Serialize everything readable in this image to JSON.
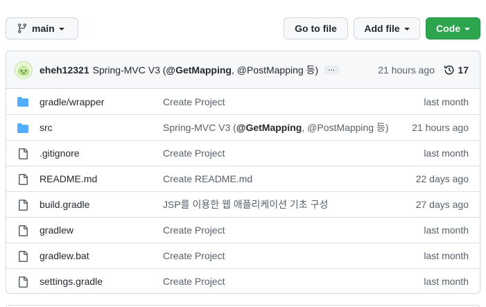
{
  "toolbar": {
    "branch_label": "main",
    "goto_file_label": "Go to file",
    "add_file_label": "Add file",
    "code_label": "Code"
  },
  "commit": {
    "author": "eheh12321",
    "message_prefix": "Spring-MVC V3 (",
    "message_bold": "@GetMapping",
    "message_suffix": ", @PostMapping 등)",
    "ellipsis": "…",
    "time": "21 hours ago",
    "history_count": "17"
  },
  "files": [
    {
      "name": "gradle/wrapper",
      "type": "folder",
      "msg": "Create Project",
      "age": "last month"
    },
    {
      "name": "src",
      "type": "folder",
      "msg_prefix": "Spring-MVC V3 (",
      "msg_bold": "@GetMapping",
      "msg_suffix": ", @PostMapping 등)",
      "age": "21 hours ago"
    },
    {
      "name": ".gitignore",
      "type": "file",
      "msg": "Create Project",
      "age": "last month"
    },
    {
      "name": "README.md",
      "type": "file",
      "msg": "Create README.md",
      "age": "22 days ago"
    },
    {
      "name": "build.gradle",
      "type": "file",
      "msg": "JSP를 이용한 웹 애플리케이션 기초 구성",
      "age": "27 days ago"
    },
    {
      "name": "gradlew",
      "type": "file",
      "msg": "Create Project",
      "age": "last month"
    },
    {
      "name": "gradlew.bat",
      "type": "file",
      "msg": "Create Project",
      "age": "last month"
    },
    {
      "name": "settings.gradle",
      "type": "file",
      "msg": "Create Project",
      "age": "last month"
    }
  ],
  "colors": {
    "folder": "#54aeff",
    "file_icon": "#57606a",
    "code_button": "#2da44e"
  }
}
